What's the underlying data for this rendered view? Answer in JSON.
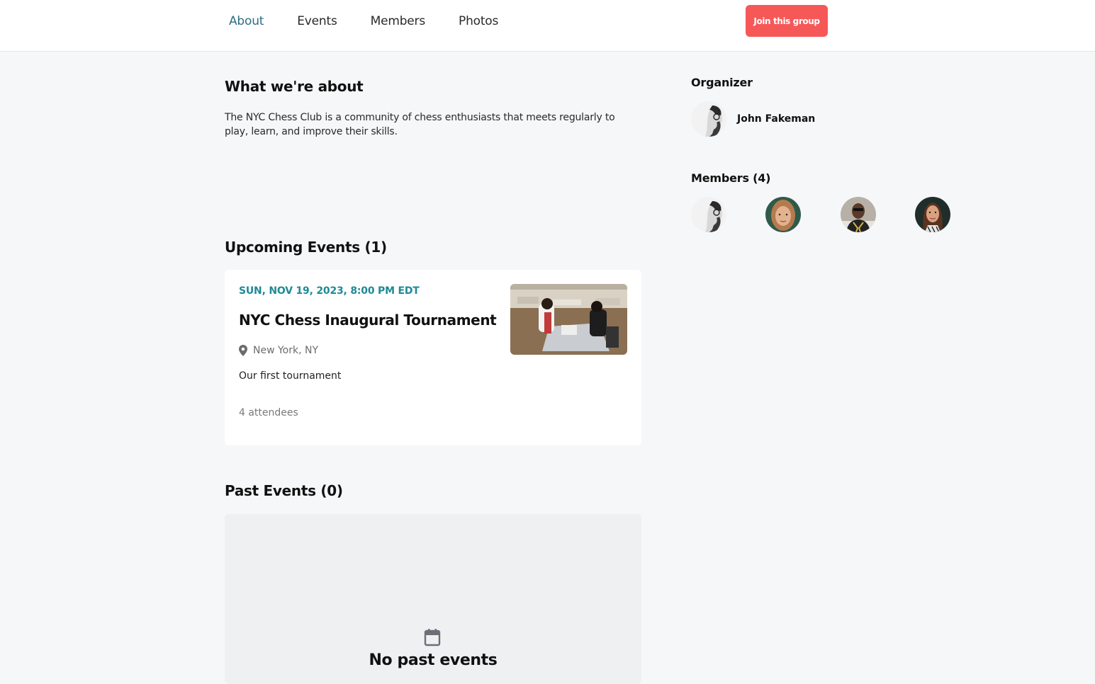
{
  "nav": {
    "tabs": [
      {
        "label": "About",
        "active": true
      },
      {
        "label": "Events",
        "active": false
      },
      {
        "label": "Members",
        "active": false
      },
      {
        "label": "Photos",
        "active": false
      }
    ],
    "join_label": "Join this group"
  },
  "about": {
    "title": "What we're about",
    "description": "The NYC Chess Club is a community of chess enthusiasts that meets regularly to play, learn, and improve their skills."
  },
  "upcoming": {
    "title": "Upcoming Events (1)",
    "events": [
      {
        "date": "SUN, NOV 19, 2023, 8:00 PM EDT",
        "title": "NYC Chess Inaugural Tournament",
        "location": "New York, NY",
        "description": "Our first tournament",
        "attendees": "4 attendees"
      }
    ]
  },
  "past": {
    "title": "Past Events (0)",
    "empty_text": "No past events"
  },
  "sidebar": {
    "organizer_title": "Organizer",
    "organizer_name": "John Fakeman",
    "members_title": "Members (4)"
  },
  "colors": {
    "accent_tab": "#2c6f83",
    "join_button": "#f65858",
    "event_date": "#1f8a95",
    "page_bg": "#f6f7f8"
  }
}
